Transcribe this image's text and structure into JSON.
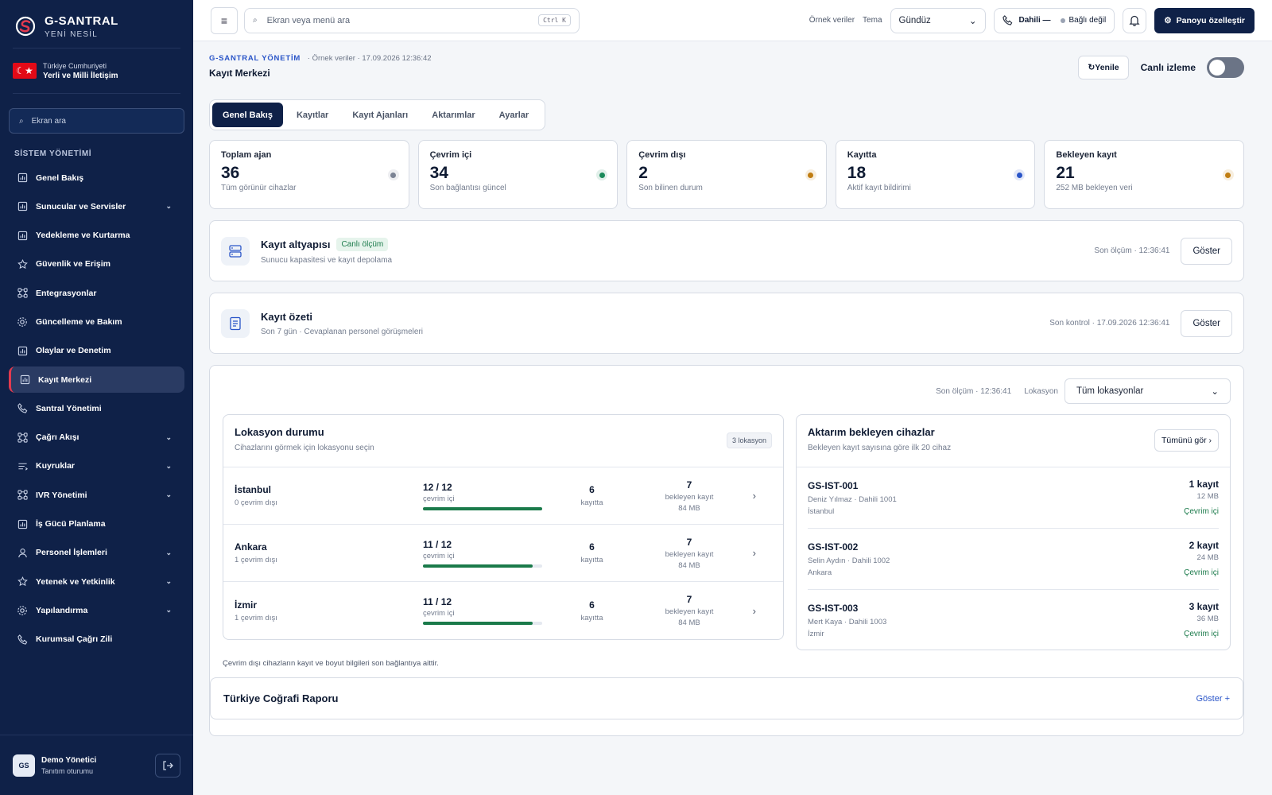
{
  "brand": {
    "title": "G-SANTRAL",
    "subtitle": "YENİ NESİL"
  },
  "country": {
    "line1": "Türkiye Cumhuriyeti",
    "line2": "Yerli ve Milli İletişim",
    "flag_symbol": "☾★"
  },
  "sidebar": {
    "search_placeholder": "Ekran ara",
    "section_title": "SİSTEM YÖNETİMİ",
    "items": [
      {
        "label": "Genel Bakış",
        "icon": "chart-icon",
        "expandable": false
      },
      {
        "label": "Sunucular ve Servisler",
        "icon": "chart-icon",
        "expandable": true
      },
      {
        "label": "Yedekleme ve Kurtarma",
        "icon": "chart-icon",
        "expandable": false
      },
      {
        "label": "Güvenlik ve Erişim",
        "icon": "star-icon",
        "expandable": false
      },
      {
        "label": "Entegrasyonlar",
        "icon": "nodes-icon",
        "expandable": false
      },
      {
        "label": "Güncelleme ve Bakım",
        "icon": "gear-icon",
        "expandable": false
      },
      {
        "label": "Olaylar ve Denetim",
        "icon": "chart-icon",
        "expandable": false
      },
      {
        "label": "Kayıt Merkezi",
        "icon": "chart-icon",
        "expandable": false,
        "active": true
      },
      {
        "label": "Santral Yönetimi",
        "icon": "phone-icon",
        "expandable": false
      },
      {
        "label": "Çağrı Akışı",
        "icon": "nodes-icon",
        "expandable": true
      },
      {
        "label": "Kuyruklar",
        "icon": "list-icon",
        "expandable": true
      },
      {
        "label": "IVR Yönetimi",
        "icon": "nodes-icon",
        "expandable": true
      },
      {
        "label": "İş Gücü Planlama",
        "icon": "chart-icon",
        "expandable": false
      },
      {
        "label": "Personel İşlemleri",
        "icon": "user-icon",
        "expandable": true
      },
      {
        "label": "Yetenek ve Yetkinlik",
        "icon": "star-icon",
        "expandable": true
      },
      {
        "label": "Yapılandırma",
        "icon": "gear-icon",
        "expandable": true
      },
      {
        "label": "Kurumsal Çağrı Zili",
        "icon": "phone-icon",
        "expandable": false
      }
    ]
  },
  "user": {
    "initials": "GS",
    "name": "Demo Yönetici",
    "role": "Tanıtım oturumu"
  },
  "topbar": {
    "menu_symbol": "≡",
    "search_placeholder": "Ekran veya menü ara",
    "shortcut": "Ctrl K",
    "sample_data": "Örnek veriler",
    "theme_label": "Tema",
    "theme_value": "Gündüz",
    "extension_label": "Dahili —",
    "connection_status": "Bağlı değil",
    "customize_label": "Panoyu özelleştir"
  },
  "header": {
    "system": "G-SANTRAL YÖNETİM",
    "meta": "· Örnek veriler · 17.09.2026 12:36:42",
    "title": "Kayıt Merkezi",
    "refresh_label": "Yenile",
    "live_label": "Canlı izleme",
    "live_on": false
  },
  "tabs": [
    "Genel Bakış",
    "Kayıtlar",
    "Kayıt Ajanları",
    "Aktarımlar",
    "Ayarlar"
  ],
  "stats": [
    {
      "label": "Toplam ajan",
      "value": "36",
      "sub": "Tüm görünür cihazlar",
      "color": "#7b8394"
    },
    {
      "label": "Çevrim içi",
      "value": "34",
      "sub": "Son bağlantısı güncel",
      "color": "#1a8a5a"
    },
    {
      "label": "Çevrim dışı",
      "value": "2",
      "sub": "Son bilinen durum",
      "color": "#c07d12"
    },
    {
      "label": "Kayıtta",
      "value": "18",
      "sub": "Aktif kayıt bildirimi",
      "color": "#2a55c8"
    },
    {
      "label": "Bekleyen kayıt",
      "value": "21",
      "sub": "252 MB bekleyen veri",
      "color": "#c07d12"
    }
  ],
  "infra": {
    "title": "Kayıt altyapısı",
    "chip": "Canlı ölçüm",
    "sub": "Sunucu kapasitesi ve kayıt depolama",
    "time": "Son ölçüm · 12:36:41",
    "button": "Göster"
  },
  "summary": {
    "title": "Kayıt özeti",
    "sub": "Son 7 gün · Cevaplanan personel görüşmeleri",
    "time": "Son kontrol · 17.09.2026 12:36:41",
    "button": "Göster"
  },
  "overview": {
    "last_measure": "Son ölçüm · 12:36:41",
    "location_label": "Lokasyon",
    "location_value": "Tüm lokasyonlar"
  },
  "locations": {
    "title": "Lokasyon durumu",
    "sub": "Cihazlarını görmek için lokasyonu seçin",
    "count": "3 lokasyon",
    "rows": [
      {
        "name": "İstanbul",
        "offline": "0 çevrim dışı",
        "online": "12 / 12",
        "online_label": "çevrim içi",
        "online_ratio": 1.0,
        "recording": "6",
        "recording_label": "kayıtta",
        "pending": "7",
        "pending_label": "bekleyen kayıt",
        "pending_size": "84 MB"
      },
      {
        "name": "Ankara",
        "offline": "1 çevrim dışı",
        "online": "11 / 12",
        "online_label": "çevrim içi",
        "online_ratio": 0.917,
        "recording": "6",
        "recording_label": "kayıtta",
        "pending": "7",
        "pending_label": "bekleyen kayıt",
        "pending_size": "84 MB"
      },
      {
        "name": "İzmir",
        "offline": "1 çevrim dışı",
        "online": "11 / 12",
        "online_label": "çevrim içi",
        "online_ratio": 0.917,
        "recording": "6",
        "recording_label": "kayıtta",
        "pending": "7",
        "pending_label": "bekleyen kayıt",
        "pending_size": "84 MB"
      }
    ]
  },
  "devices": {
    "title": "Aktarım bekleyen cihazlar",
    "sub": "Bekleyen kayıt sayısına göre ilk 20 cihaz",
    "see_all": "Tümünü gör ›",
    "rows": [
      {
        "id": "GS-IST-001",
        "user": "Deniz Yılmaz · Dahili 1001",
        "city": "İstanbul",
        "records": "1 kayıt",
        "size": "12 MB",
        "status": "Çevrim içi"
      },
      {
        "id": "GS-IST-002",
        "user": "Selin Aydın · Dahili 1002",
        "city": "Ankara",
        "records": "2 kayıt",
        "size": "24 MB",
        "status": "Çevrim içi"
      },
      {
        "id": "GS-IST-003",
        "user": "Mert Kaya · Dahili 1003",
        "city": "İzmir",
        "records": "3 kayıt",
        "size": "36 MB",
        "status": "Çevrim içi"
      }
    ]
  },
  "footnote": "Çevrim dışı cihazların kayıt ve boyut bilgileri son bağlantıya aittir.",
  "geo": {
    "title": "Türkiye Coğrafi Raporu",
    "action": "Göster +"
  }
}
